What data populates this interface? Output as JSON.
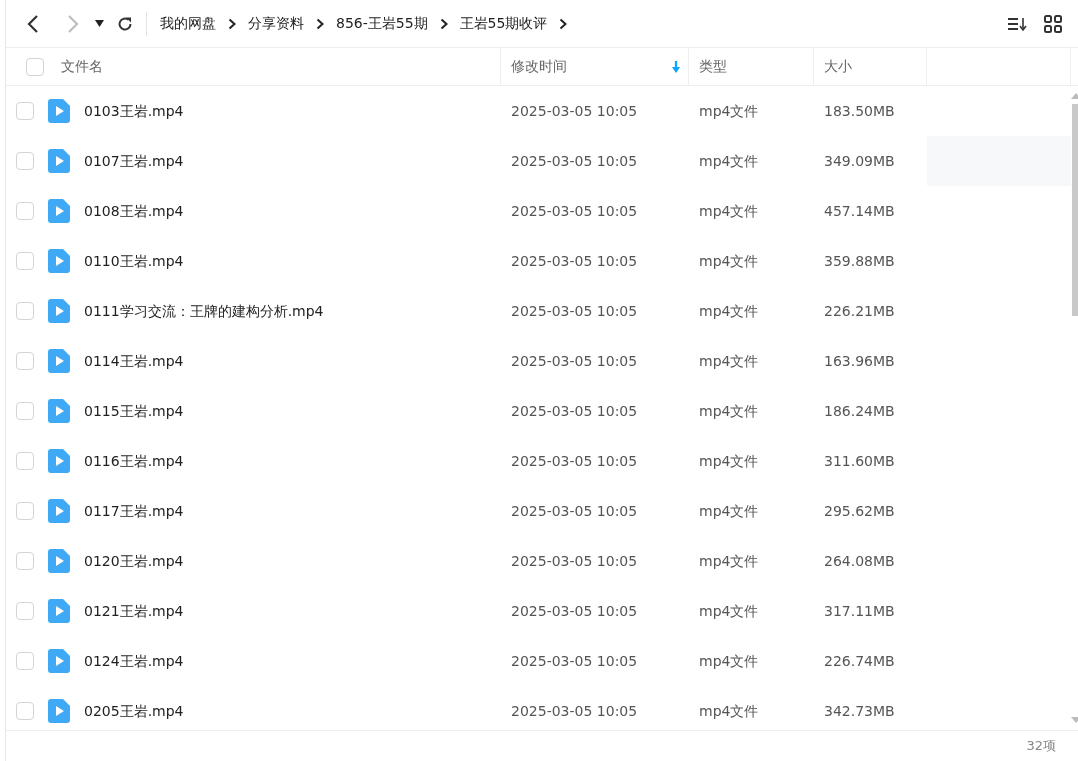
{
  "breadcrumb": [
    "我的网盘",
    "分享资料",
    "856-王岩55期",
    "王岩55期收评"
  ],
  "columns": [
    {
      "label": "文件名",
      "sorted": false
    },
    {
      "label": "修改时间",
      "sorted": true
    },
    {
      "label": "类型",
      "sorted": false
    },
    {
      "label": "大小",
      "sorted": false
    }
  ],
  "select_all": {
    "checked": false
  },
  "rows": [
    {
      "name": "0103王岩.mp4",
      "modified": "2025-03-05 10:05",
      "type": "mp4文件",
      "size": "183.50MB",
      "checked": false,
      "hovered": false
    },
    {
      "name": "0107王岩.mp4",
      "modified": "2025-03-05 10:05",
      "type": "mp4文件",
      "size": "349.09MB",
      "checked": false,
      "hovered": true
    },
    {
      "name": "0108王岩.mp4",
      "modified": "2025-03-05 10:05",
      "type": "mp4文件",
      "size": "457.14MB",
      "checked": false,
      "hovered": false
    },
    {
      "name": "0110王岩.mp4",
      "modified": "2025-03-05 10:05",
      "type": "mp4文件",
      "size": "359.88MB",
      "checked": false,
      "hovered": false
    },
    {
      "name": "0111学习交流：王牌的建构分析.mp4",
      "modified": "2025-03-05 10:05",
      "type": "mp4文件",
      "size": "226.21MB",
      "checked": false,
      "hovered": false
    },
    {
      "name": "0114王岩.mp4",
      "modified": "2025-03-05 10:05",
      "type": "mp4文件",
      "size": "163.96MB",
      "checked": false,
      "hovered": false
    },
    {
      "name": "0115王岩.mp4",
      "modified": "2025-03-05 10:05",
      "type": "mp4文件",
      "size": "186.24MB",
      "checked": false,
      "hovered": false
    },
    {
      "name": "0116王岩.mp4",
      "modified": "2025-03-05 10:05",
      "type": "mp4文件",
      "size": "311.60MB",
      "checked": false,
      "hovered": false
    },
    {
      "name": "0117王岩.mp4",
      "modified": "2025-03-05 10:05",
      "type": "mp4文件",
      "size": "295.62MB",
      "checked": false,
      "hovered": false
    },
    {
      "name": "0120王岩.mp4",
      "modified": "2025-03-05 10:05",
      "type": "mp4文件",
      "size": "264.08MB",
      "checked": false,
      "hovered": false
    },
    {
      "name": "0121王岩.mp4",
      "modified": "2025-03-05 10:05",
      "type": "mp4文件",
      "size": "317.11MB",
      "checked": false,
      "hovered": false
    },
    {
      "name": "0124王岩.mp4",
      "modified": "2025-03-05 10:05",
      "type": "mp4文件",
      "size": "226.74MB",
      "checked": false,
      "hovered": false
    },
    {
      "name": "0205王岩.mp4",
      "modified": "2025-03-05 10:05",
      "type": "mp4文件",
      "size": "342.73MB",
      "checked": false,
      "hovered": false
    }
  ],
  "status_bar": {
    "count": "32项"
  }
}
